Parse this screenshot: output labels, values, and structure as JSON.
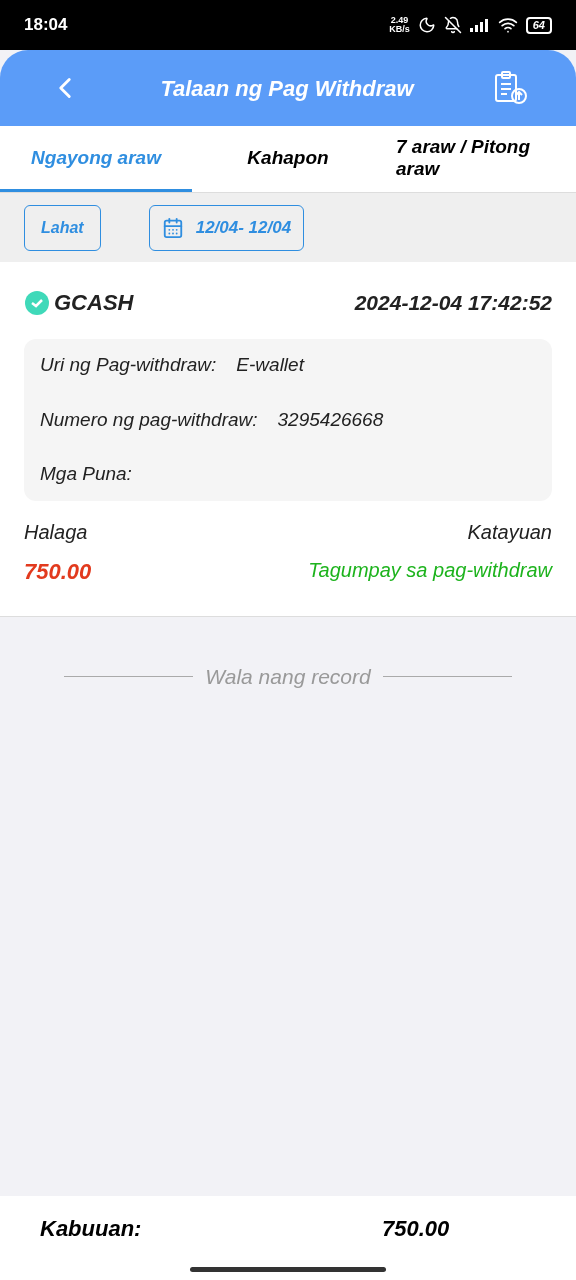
{
  "status_bar": {
    "time": "18:04",
    "net_speed": "2.49",
    "net_unit": "KB/s",
    "battery": "64"
  },
  "header": {
    "title": "Talaan ng Pag Withdraw"
  },
  "tabs": [
    {
      "label": "Ngayong araw",
      "selected": true
    },
    {
      "label": "Kahapon",
      "selected": false
    },
    {
      "label": "7 araw / Pitong araw",
      "selected": false
    }
  ],
  "filters": {
    "all": "Lahat",
    "date_range": "12/04- 12/04"
  },
  "records": [
    {
      "method": "GCASH",
      "datetime": "2024-12-04 17:42:52",
      "details": [
        {
          "label": "Uri ng Pag-withdraw:",
          "value": "E-wallet"
        },
        {
          "label": "Numero ng pag-withdraw:",
          "value": "3295426668"
        },
        {
          "label": "Mga Puna:"
        }
      ],
      "amount_label": "Halaga",
      "amount": "750.00",
      "status_label": "Katayuan",
      "status": "Tagumpay sa pag-withdraw"
    }
  ],
  "end_note": "Wala nang record",
  "footer": {
    "label": "Kabuuan:",
    "total": "750.00"
  }
}
